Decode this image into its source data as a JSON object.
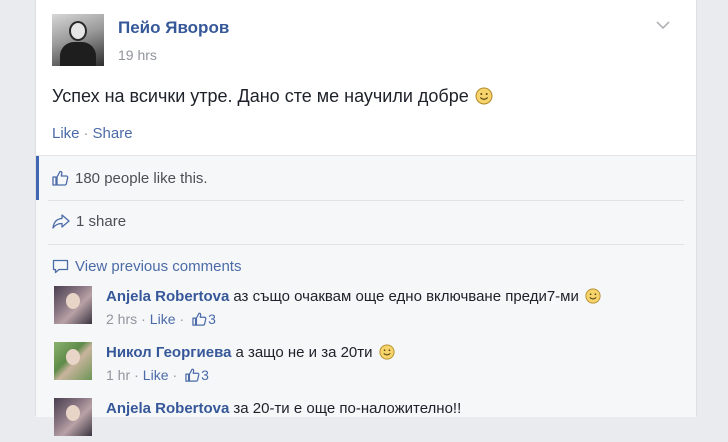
{
  "post": {
    "author": "Пейо Яворов",
    "time": "19 hrs",
    "text": "Успех на всички утре. Дано сте ме научили добре",
    "like_label": "Like",
    "share_label": "Share",
    "separator": "·"
  },
  "ufi": {
    "likes_text": "180 people like this.",
    "shares_text": "1 share",
    "view_previous": "View previous comments"
  },
  "comments": [
    {
      "author": "Anjela Robertova",
      "text": "аз също очаквам още едно включване преди7-ми",
      "time": "2 hrs",
      "like_label": "Like",
      "likes": "3",
      "has_smile": true
    },
    {
      "author": "Никол Георгиева",
      "text": "а защо не и за 20ти",
      "time": "1 hr",
      "like_label": "Like",
      "likes": "3",
      "has_smile": true
    },
    {
      "author": "Anjela Robertova",
      "text": "за 20-ти е още по-наложително!!",
      "time": "",
      "like_label": "",
      "likes": "",
      "has_smile": false
    }
  ],
  "colors": {
    "link": "#365899",
    "accent": "#4267b2",
    "meta": "#90949c",
    "background": "#e9ebee"
  },
  "icons": [
    "chevron-down-icon",
    "smiley-icon",
    "thumbs-up-icon",
    "share-icon",
    "comment-icon"
  ]
}
